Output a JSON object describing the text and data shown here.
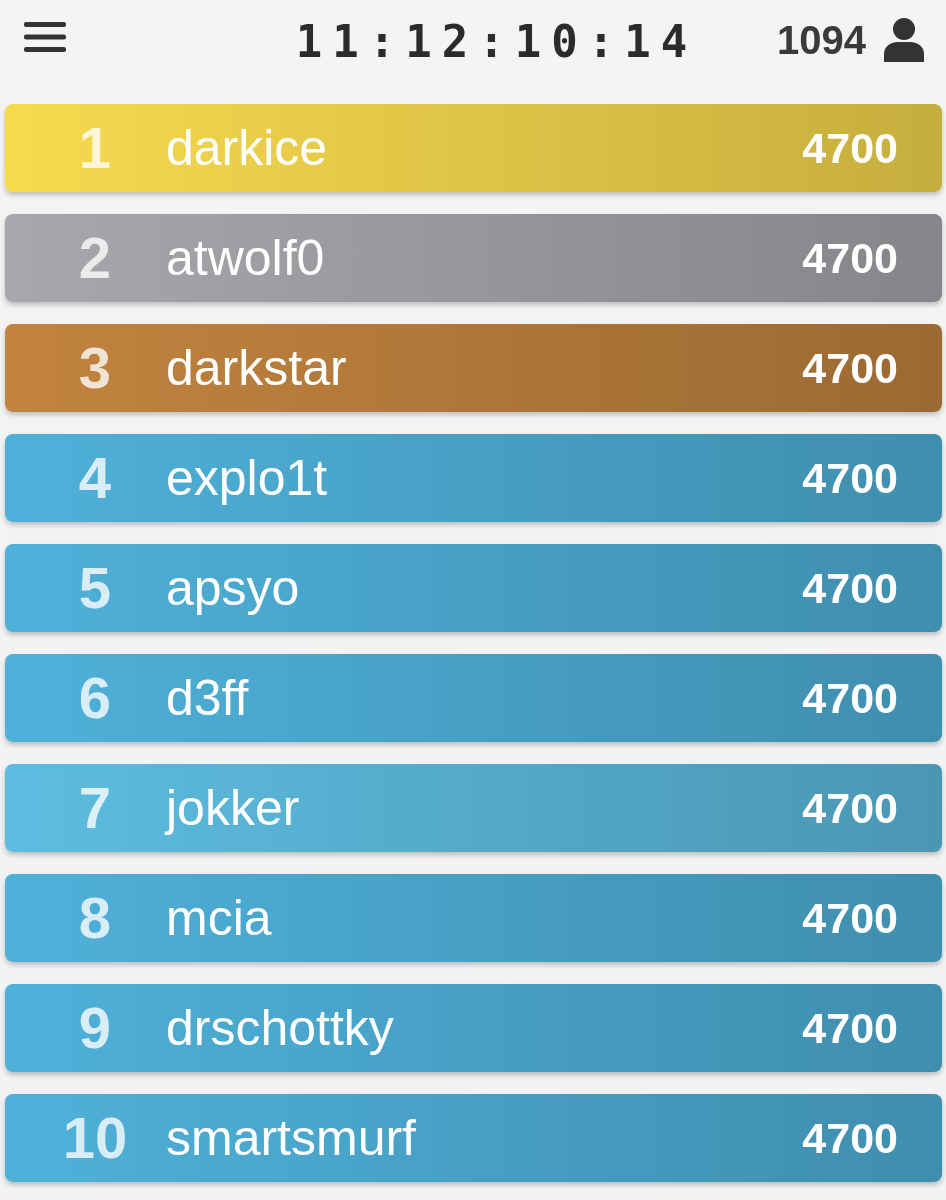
{
  "header": {
    "clock": "11:12:10:14",
    "points": "1094"
  },
  "leaderboard": [
    {
      "rank": "1",
      "name": "darkice",
      "score": "4700",
      "color": "#f7da4e"
    },
    {
      "rank": "2",
      "name": "atwolf0",
      "score": "4700",
      "color": "#a8a8ac"
    },
    {
      "rank": "3",
      "name": "darkstar",
      "score": "4700",
      "color": "#c2843f"
    },
    {
      "rank": "4",
      "name": "explo1t",
      "score": "4700",
      "color": "#4fb1da"
    },
    {
      "rank": "5",
      "name": "apsyo",
      "score": "4700",
      "color": "#4fb1da"
    },
    {
      "rank": "6",
      "name": "d3ff",
      "score": "4700",
      "color": "#4fb1da"
    },
    {
      "rank": "7",
      "name": "jokker",
      "score": "4700",
      "color": "#5dbde0"
    },
    {
      "rank": "8",
      "name": "mcia",
      "score": "4700",
      "color": "#4fb1da"
    },
    {
      "rank": "9",
      "name": "drschottky",
      "score": "4700",
      "color": "#4fb1da"
    },
    {
      "rank": "10",
      "name": "smartsmurf",
      "score": "4700",
      "color": "#4fb1da"
    }
  ]
}
